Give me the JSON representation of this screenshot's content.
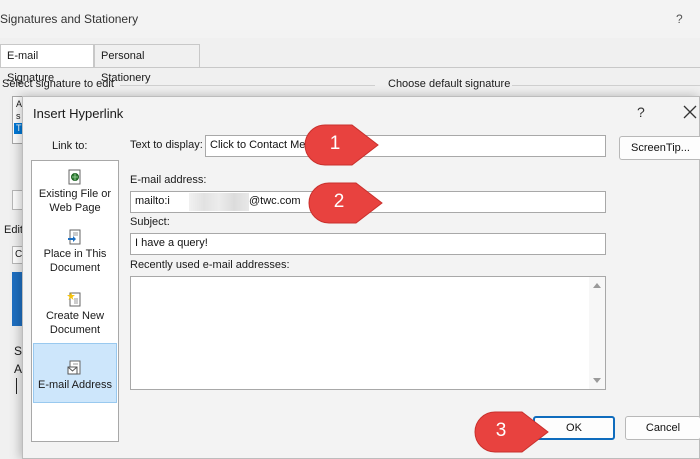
{
  "background_window": {
    "title": "Signatures and Stationery",
    "help_label": "?",
    "tabs": [
      {
        "label": "E-mail Signature",
        "active": true
      },
      {
        "label": "Personal Stationery",
        "active": false
      }
    ],
    "select_signature_label": "Select signature to edit",
    "choose_default_label": "Choose default signature",
    "signature_list_fragments": [
      "A",
      "s",
      "T"
    ],
    "edit_label_fragment": "Edit",
    "font_combo_fragment": "C",
    "editor_text_fragments": [
      "S",
      "A"
    ]
  },
  "dialog": {
    "title": "Insert Hyperlink",
    "help_label": "?",
    "link_to_label": "Link to:",
    "link_to_items": [
      {
        "label": "Existing File or Web Page",
        "icon": "web-page-icon",
        "selected": false
      },
      {
        "label": "Place in This Document",
        "icon": "document-place-icon",
        "selected": false
      },
      {
        "label": "Create New Document",
        "icon": "new-document-icon",
        "selected": false
      },
      {
        "label": "E-mail Address",
        "icon": "email-icon",
        "selected": true
      }
    ],
    "text_to_display_label": "Text to display:",
    "text_to_display_value": "Click to Contact Me!",
    "screentip_label": "ScreenTip...",
    "email_address_label": "E-mail address:",
    "email_address_prefix": "mailto:i",
    "email_address_suffix": "@twc.com",
    "subject_label": "Subject:",
    "subject_value": "I have a query!",
    "recent_label": "Recently used e-mail addresses:",
    "ok_label": "OK",
    "cancel_label": "Cancel"
  },
  "callouts": [
    "1",
    "2",
    "3"
  ],
  "colors": {
    "callout_red": "#e8423f",
    "selection_blue": "#cde6fb",
    "ok_border": "#0f6cbd"
  }
}
